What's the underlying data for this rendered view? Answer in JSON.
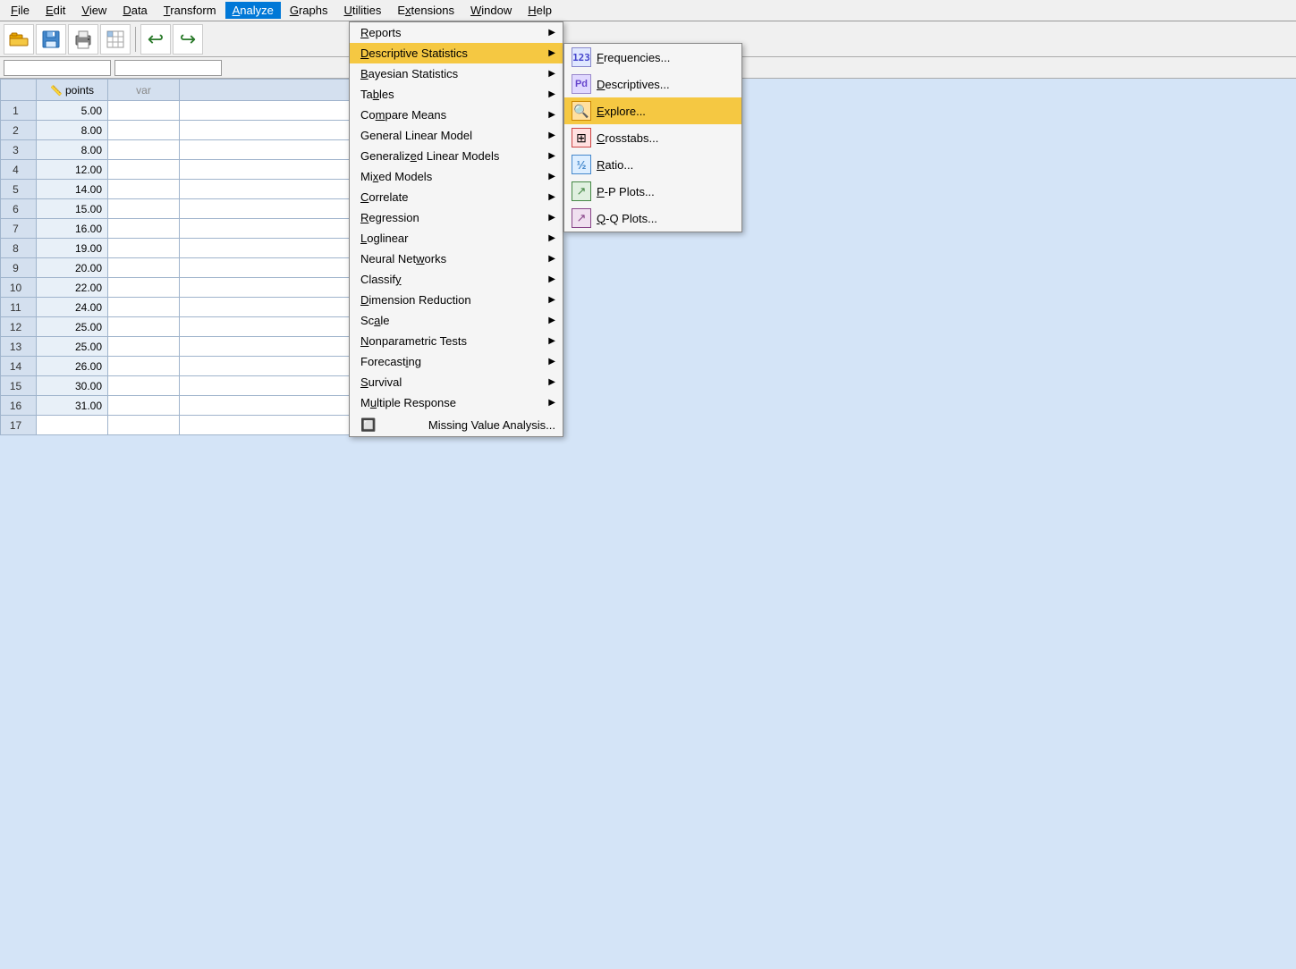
{
  "menubar": {
    "items": [
      {
        "id": "file",
        "label": "File",
        "underline": "F"
      },
      {
        "id": "edit",
        "label": "Edit",
        "underline": "E"
      },
      {
        "id": "view",
        "label": "View",
        "underline": "V"
      },
      {
        "id": "data",
        "label": "Data",
        "underline": "D"
      },
      {
        "id": "transform",
        "label": "Transform",
        "underline": "T"
      },
      {
        "id": "analyze",
        "label": "Analyze",
        "underline": "A"
      },
      {
        "id": "graphs",
        "label": "Graphs",
        "underline": "G"
      },
      {
        "id": "utilities",
        "label": "Utilities",
        "underline": "U"
      },
      {
        "id": "extensions",
        "label": "Extensions",
        "underline": "x"
      },
      {
        "id": "window",
        "label": "Window",
        "underline": "W"
      },
      {
        "id": "help",
        "label": "Help",
        "underline": "H"
      }
    ]
  },
  "analyze_menu": {
    "items": [
      {
        "id": "reports",
        "label": "Reports",
        "has_submenu": true
      },
      {
        "id": "descriptive_statistics",
        "label": "Descriptive Statistics",
        "has_submenu": true,
        "highlighted": true
      },
      {
        "id": "bayesian_statistics",
        "label": "Bayesian Statistics",
        "has_submenu": true
      },
      {
        "id": "tables",
        "label": "Tables",
        "has_submenu": true
      },
      {
        "id": "compare_means",
        "label": "Compare Means",
        "has_submenu": true
      },
      {
        "id": "general_linear_model",
        "label": "General Linear Model",
        "has_submenu": true
      },
      {
        "id": "generalized_linear_models",
        "label": "Generalized Linear Models",
        "has_submenu": true
      },
      {
        "id": "mixed_models",
        "label": "Mixed Models",
        "has_submenu": true
      },
      {
        "id": "correlate",
        "label": "Correlate",
        "has_submenu": true
      },
      {
        "id": "regression",
        "label": "Regression",
        "has_submenu": true
      },
      {
        "id": "loglinear",
        "label": "Loglinear",
        "has_submenu": true
      },
      {
        "id": "neural_networks",
        "label": "Neural Networks",
        "has_submenu": true
      },
      {
        "id": "classify",
        "label": "Classify",
        "has_submenu": true
      },
      {
        "id": "dimension_reduction",
        "label": "Dimension Reduction",
        "has_submenu": true
      },
      {
        "id": "scale",
        "label": "Scale",
        "has_submenu": true
      },
      {
        "id": "nonparametric_tests",
        "label": "Nonparametric Tests",
        "has_submenu": true
      },
      {
        "id": "forecasting",
        "label": "Forecasting",
        "has_submenu": true
      },
      {
        "id": "survival",
        "label": "Survival",
        "has_submenu": true
      },
      {
        "id": "multiple_response",
        "label": "Multiple Response",
        "has_submenu": true
      },
      {
        "id": "missing_value_analysis",
        "label": "Missing Value Analysis...",
        "has_submenu": false,
        "has_icon": true
      }
    ]
  },
  "descriptive_submenu": {
    "items": [
      {
        "id": "frequencies",
        "label": "Frequencies...",
        "icon": "123",
        "icon_class": "icon-freq"
      },
      {
        "id": "descriptives",
        "label": "Descriptives...",
        "icon": "Pd",
        "icon_class": "icon-desc"
      },
      {
        "id": "explore",
        "label": "Explore...",
        "icon": "🔍",
        "icon_class": "icon-explore",
        "highlighted": true
      },
      {
        "id": "crosstabs",
        "label": "Crosstabs...",
        "icon": "⊞",
        "icon_class": "icon-crosstabs"
      },
      {
        "id": "ratio",
        "label": "Ratio...",
        "icon": "½",
        "icon_class": "icon-ratio"
      },
      {
        "id": "pp_plots",
        "label": "P-P Plots...",
        "icon": "↗",
        "icon_class": "icon-pp"
      },
      {
        "id": "qq_plots",
        "label": "Q-Q Plots...",
        "icon": "↗",
        "icon_class": "icon-qq"
      }
    ]
  },
  "grid": {
    "columns": [
      {
        "id": "points",
        "label": "points",
        "icon": "📏"
      },
      {
        "id": "var",
        "label": "var"
      }
    ],
    "rows": [
      {
        "num": 1,
        "points": "5.00"
      },
      {
        "num": 2,
        "points": "8.00"
      },
      {
        "num": 3,
        "points": "8.00"
      },
      {
        "num": 4,
        "points": "12.00"
      },
      {
        "num": 5,
        "points": "14.00"
      },
      {
        "num": 6,
        "points": "15.00"
      },
      {
        "num": 7,
        "points": "16.00"
      },
      {
        "num": 8,
        "points": "19.00"
      },
      {
        "num": 9,
        "points": "20.00"
      },
      {
        "num": 10,
        "points": "22.00"
      },
      {
        "num": 11,
        "points": "24.00"
      },
      {
        "num": 12,
        "points": "25.00"
      },
      {
        "num": 13,
        "points": "25.00"
      },
      {
        "num": 14,
        "points": "26.00"
      },
      {
        "num": 15,
        "points": "30.00"
      },
      {
        "num": 16,
        "points": "31.00"
      },
      {
        "num": 17,
        "points": ""
      }
    ]
  }
}
